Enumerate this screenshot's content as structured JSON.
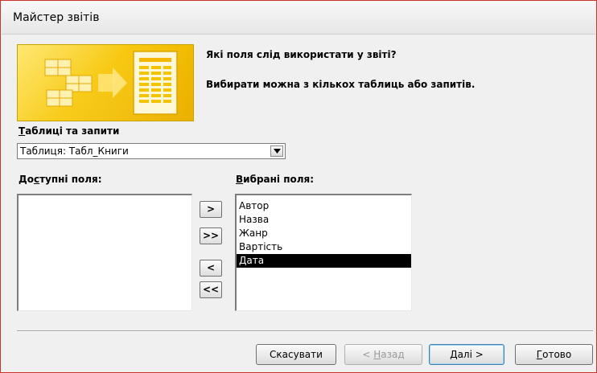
{
  "window": {
    "title": "Майстер звітів"
  },
  "intro": {
    "question": "Які поля слід використати у звіті?",
    "hint": "Вибирати можна з кількох таблиць або запитів."
  },
  "tables": {
    "label_key": "Т",
    "label_rest": "аблиці та запити",
    "selected": "Таблиця: Табл_Книги"
  },
  "available": {
    "label_pre": "До",
    "label_key": "с",
    "label_rest": "тупні поля:",
    "items": []
  },
  "selected_fields": {
    "label_key": "В",
    "label_rest": "ибрані поля:",
    "items": [
      "Автор",
      "Назва",
      "Жанр",
      "Вартість",
      "Дата"
    ],
    "selected_index": 4
  },
  "move_buttons": {
    "add_one": ">",
    "add_all": ">>",
    "remove_one": "<",
    "remove_all": "<<"
  },
  "footer": {
    "cancel": "Скасувати",
    "back_pre": "< ",
    "back_key": "Н",
    "back_rest": "азад",
    "next_key": "Д",
    "next_rest": "алі >",
    "finish_key": "Г",
    "finish_rest": "отово"
  }
}
